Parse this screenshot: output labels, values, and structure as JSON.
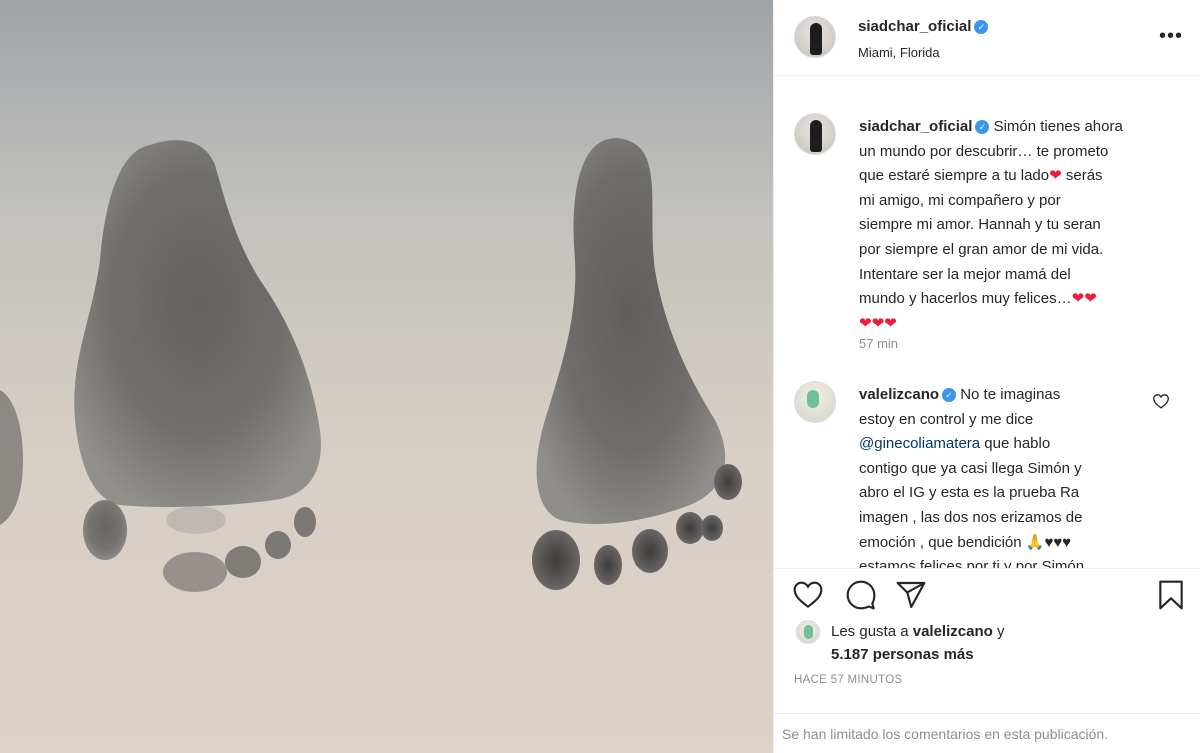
{
  "post": {
    "author": "siadchar_oficial",
    "location": "Miami, Florida",
    "caption": {
      "lines": [
        "Simón tienes ahora",
        "un mundo por descubrir… te prometo",
        "que estaré siempre a tu lado",
        "serás",
        "mi amigo, mi compañero y por",
        "siempre mi amor. Hannah y tu seran",
        "por siempre el gran amor de mi vida.",
        "Intentare ser la mejor mamá del",
        "mundo y hacerlos muy felices…"
      ],
      "heart": "❤",
      "time": "57 min"
    },
    "comment": {
      "author": "valelizcano",
      "lines": [
        "No te imaginas",
        "estoy en control y me dice",
        "@ginecoliamatera",
        "que hablo",
        "contigo que ya casi llega Simón y",
        "abro el IG y esta es la prueba Ra",
        "imagen , las dos nos erizamos de",
        "emoción , que bendición",
        "🙏",
        "♥♥♥",
        "estamos felices por ti y por Simón"
      ]
    },
    "likes": {
      "prefix": "Les gusta a",
      "liker": "valelizcano",
      "joiner": "y",
      "count_text": "5.187 personas más"
    },
    "posted_ago": "HACE 57 MINUTOS",
    "comments_limited": "Se han limitado los comentarios en esta publicación."
  },
  "icons": {
    "verified": "✓",
    "more": "•••"
  },
  "colors": {
    "verified_blue": "#3897f0",
    "heart_red": "#ed1c3b",
    "muted_text": "#8e8e8e",
    "mention": "#00376b"
  }
}
